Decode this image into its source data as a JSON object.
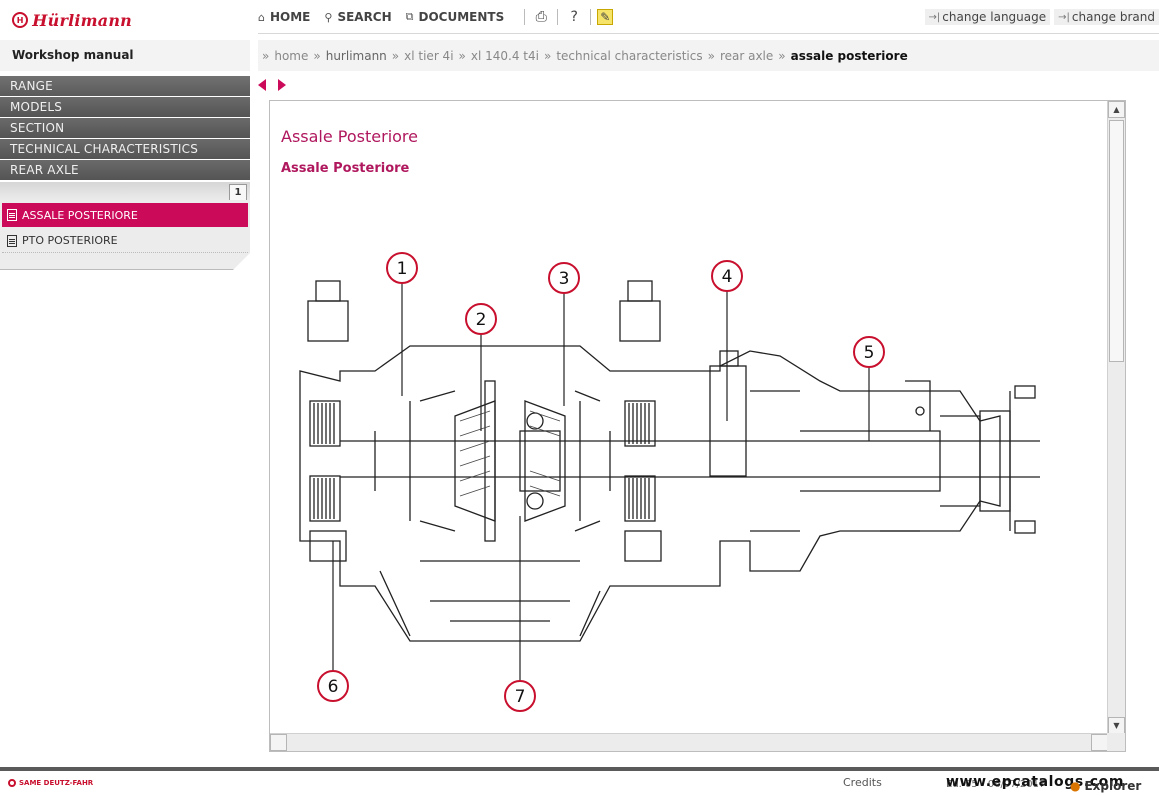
{
  "brand": {
    "logo_text": "Hürlimann",
    "logo_badge": "H"
  },
  "topnav": {
    "home": "HOME",
    "search": "SEARCH",
    "documents": "DOCUMENTS",
    "change_language": "change language",
    "change_brand": "change brand"
  },
  "sidebar": {
    "title": "Workshop manual",
    "menu": [
      "RANGE",
      "MODELS",
      "SECTION",
      "TECHNICAL CHARACTERISTICS",
      "REAR AXLE"
    ],
    "page_number": "1",
    "documents": [
      {
        "label": "ASSALE POSTERIORE",
        "active": true
      },
      {
        "label": "PTO POSTERIORE",
        "active": false
      }
    ]
  },
  "breadcrumb": [
    {
      "label": "home",
      "style": "link"
    },
    {
      "label": "hurlimann",
      "style": "plain"
    },
    {
      "label": "xl tier 4i",
      "style": "link"
    },
    {
      "label": "xl 140.4 t4i",
      "style": "link"
    },
    {
      "label": "technical characteristics",
      "style": "link"
    },
    {
      "label": "rear axle",
      "style": "link"
    },
    {
      "label": "assale posteriore",
      "style": "current"
    }
  ],
  "content": {
    "title": "Assale Posteriore",
    "subtitle": "Assale Posteriore",
    "callouts": [
      "1",
      "2",
      "3",
      "4",
      "5",
      "6",
      "7"
    ]
  },
  "footer": {
    "company": "SAME DEUTZ-FAHR",
    "credits": "Credits",
    "version": "Ed. 05 - 06/07/2017",
    "watermark": "www.epcatalogs.com",
    "explorer": "Explorer"
  },
  "colors": {
    "accent": "#cc0a5a",
    "brand_red": "#c8102e",
    "menu_bg": "#5f5f5f"
  }
}
